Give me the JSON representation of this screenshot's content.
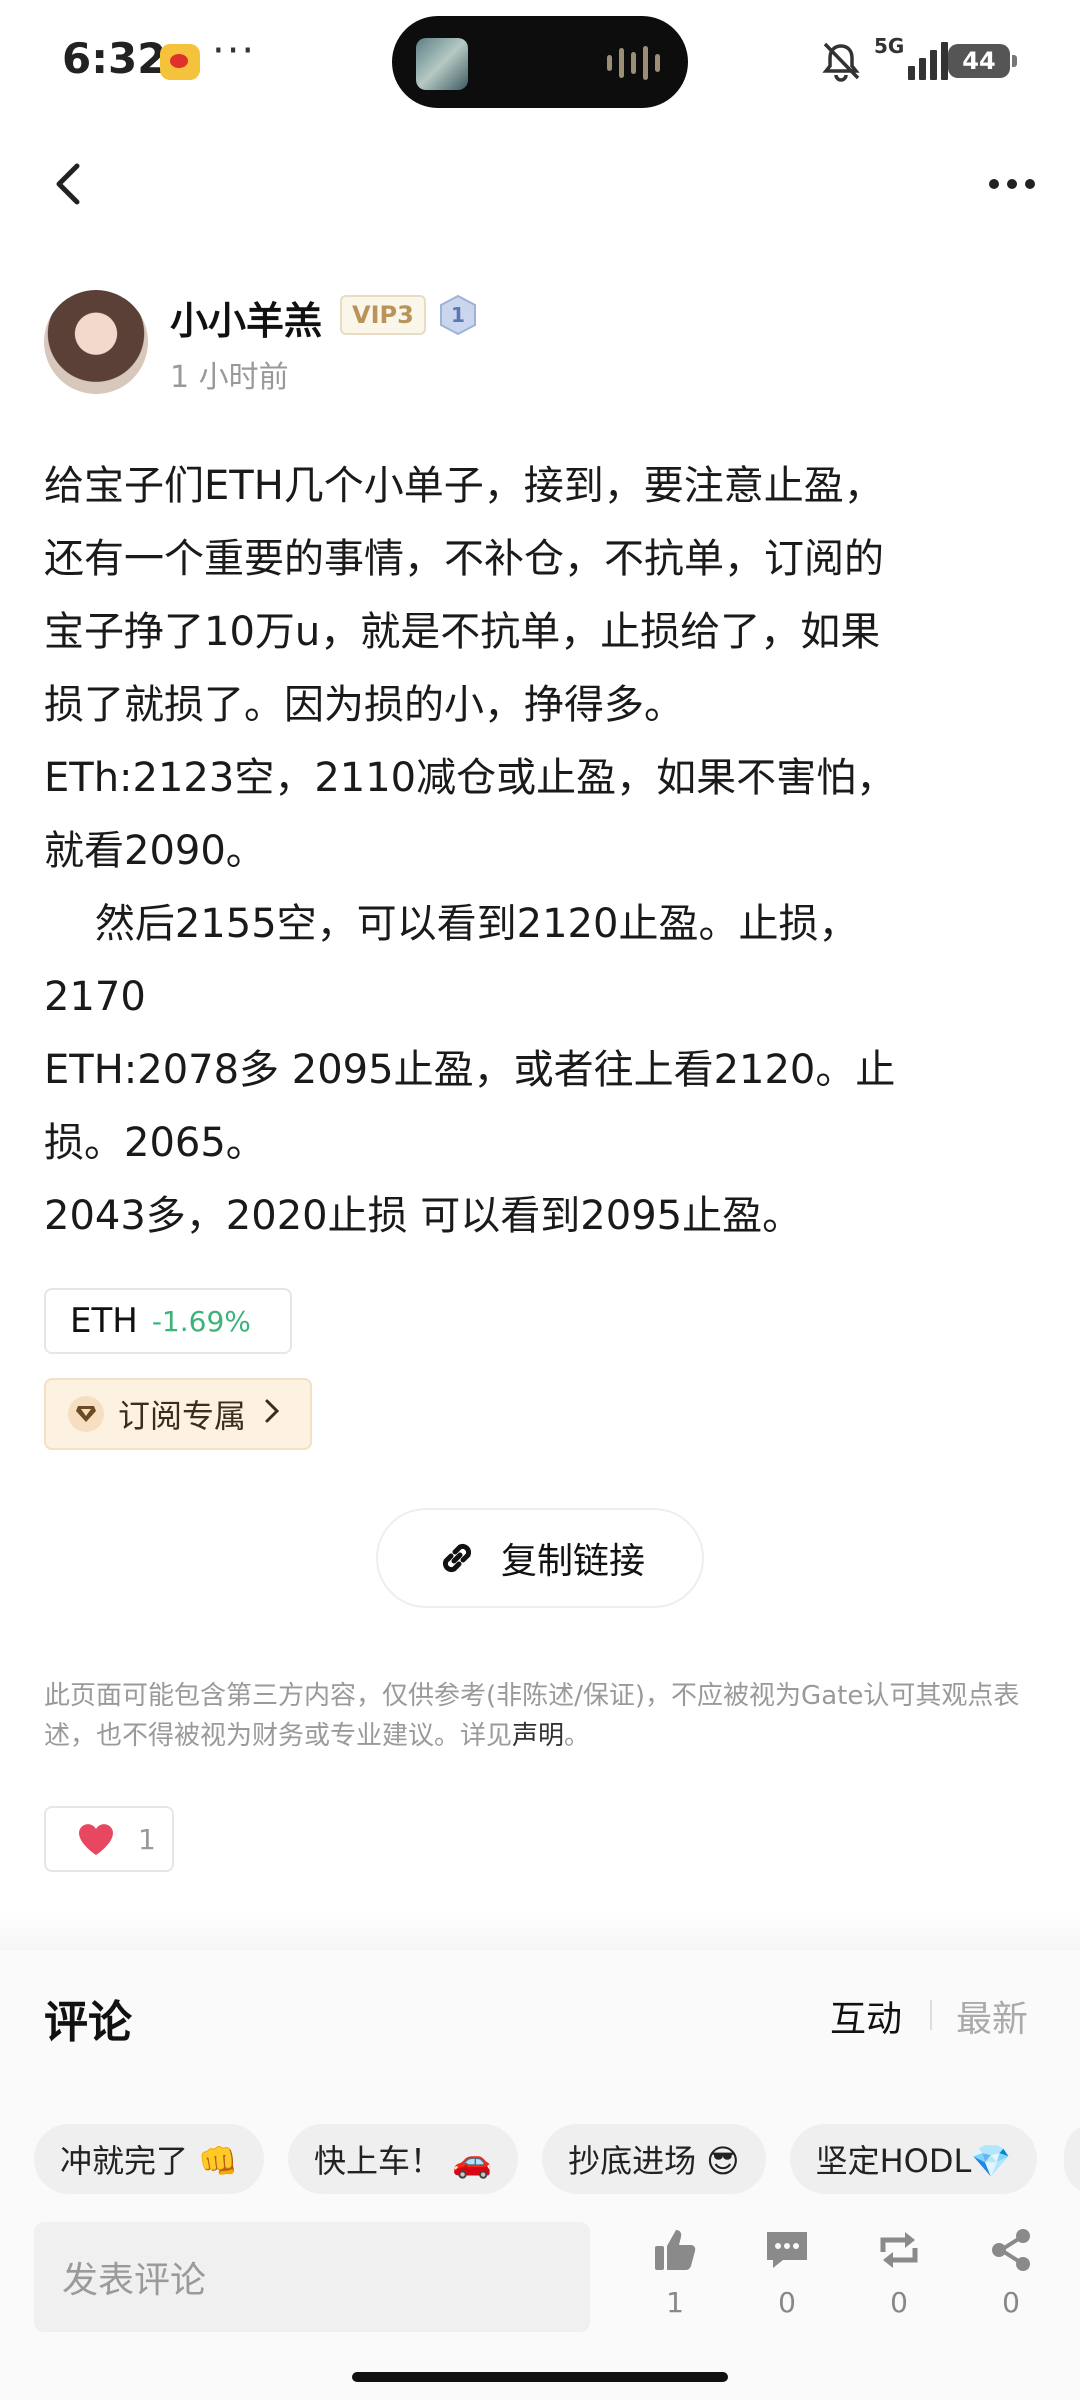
{
  "status_bar": {
    "time": "6:32",
    "dots": "···",
    "network": "5G",
    "battery": "44"
  },
  "author": {
    "name": "小小羊羔",
    "vip": "VIP3",
    "level": "1",
    "time": "1 小时前"
  },
  "post": {
    "lines": [
      "给宝子们ETH几个小单子，接到，要注意止盈，",
      "还有一个重要的事情，不补仓，不抗单，订阅的",
      "宝子挣了10万u，就是不抗单，止损给了，如果",
      "损了就损了。因为损的小，挣得多。",
      "ETh:2123空，2110减仓或止盈，如果不害怕，",
      "就看2090。",
      "    然后2155空，可以看到2120止盈。止损，",
      "2170",
      "ETH:2078多 2095止盈，或者往上看2120。止",
      "损。2065。",
      "2043多，2020止损 可以看到2095止盈。"
    ]
  },
  "token": {
    "symbol": "ETH",
    "change": "-1.69%",
    "change_color": "#3cb37a"
  },
  "subscription": {
    "label": "订阅专属"
  },
  "copy_link": {
    "label": "复制链接"
  },
  "disclaimer": {
    "text": "此页面可能包含第三方内容，仅供参考(非陈述/保证)，不应被视为Gate认可其观点表述，也不得被视为财务或专业建议。详见",
    "link": "声明",
    "suffix": "。"
  },
  "like": {
    "count": "1"
  },
  "comments": {
    "title": "评论",
    "tabs": [
      "互动",
      "最新"
    ],
    "quick_replies": [
      "冲就完了 👊",
      "快上车！ 🚗",
      "抄底进场 😎",
      "坚定HODL💎"
    ],
    "input_placeholder": "发表评论"
  },
  "actions": [
    {
      "name": "like",
      "icon": "thumbs-up-icon",
      "count": "1"
    },
    {
      "name": "comment",
      "icon": "comment-icon",
      "count": "0"
    },
    {
      "name": "repost",
      "icon": "repost-icon",
      "count": "0"
    },
    {
      "name": "share",
      "icon": "share-icon",
      "count": "0"
    }
  ]
}
